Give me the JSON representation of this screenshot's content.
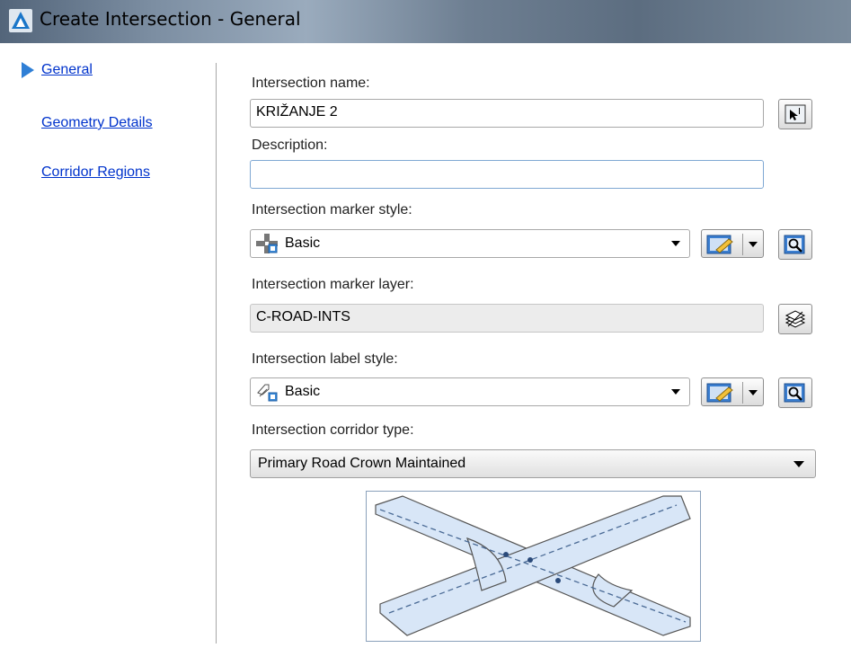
{
  "window": {
    "title": "Create Intersection - General",
    "icon": "autocad-civil-icon"
  },
  "nav": {
    "items": [
      {
        "label": "General",
        "active": true
      },
      {
        "label": "Geometry Details"
      },
      {
        "label": "Corridor Regions"
      }
    ]
  },
  "form": {
    "name_label": "Intersection name:",
    "name_value": "KRIŽANJE 2",
    "description_label": "Description:",
    "description_value": "",
    "marker_style_label": "Intersection marker style:",
    "marker_style_value": "Basic",
    "marker_layer_label": "Intersection marker layer:",
    "marker_layer_value": "C-ROAD-INTS",
    "label_style_label": "Intersection label style:",
    "label_style_value": "Basic",
    "corridor_type_label": "Intersection corridor type:",
    "corridor_type_value": "Primary Road Crown Maintained"
  },
  "colors": {
    "link": "#0033cc",
    "nav_marker": "#2f7fd6",
    "road_fill": "#d8e6f7"
  }
}
